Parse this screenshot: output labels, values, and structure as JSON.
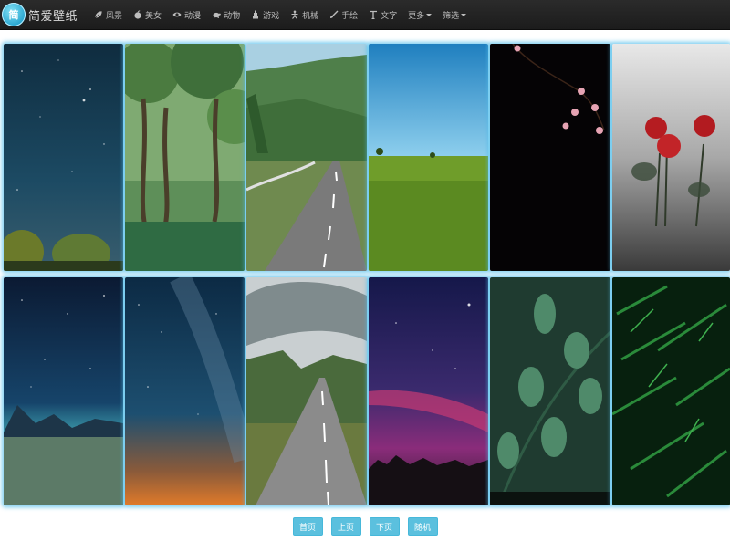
{
  "site": {
    "logo_text": "简",
    "title": "简爱壁纸"
  },
  "nav": {
    "items": [
      {
        "label": "风景",
        "icon": "leaf-icon"
      },
      {
        "label": "美女",
        "icon": "apple-icon"
      },
      {
        "label": "动漫",
        "icon": "eye-icon"
      },
      {
        "label": "动物",
        "icon": "turtle-icon"
      },
      {
        "label": "游戏",
        "icon": "tower-icon"
      },
      {
        "label": "机械",
        "icon": "robot-icon"
      },
      {
        "label": "手绘",
        "icon": "brush-icon"
      },
      {
        "label": "文字",
        "icon": "text-icon"
      }
    ],
    "more_label": "更多",
    "filter_label": "筛选"
  },
  "gallery": {
    "wallpapers": [
      {
        "subject": "starry sky with trees"
      },
      {
        "subject": "green tree-lined path"
      },
      {
        "subject": "road through green mountains"
      },
      {
        "subject": "green wheat field and blue sky"
      },
      {
        "subject": "pink blossoms on black"
      },
      {
        "subject": "red roses in fog"
      },
      {
        "subject": "night sky over grassland"
      },
      {
        "subject": "milky way"
      },
      {
        "subject": "road into misty forest"
      },
      {
        "subject": "purple night sky"
      },
      {
        "subject": "green leaves"
      },
      {
        "subject": "ferns"
      }
    ]
  },
  "pagination": {
    "first": "首页",
    "prev": "上页",
    "next": "下页",
    "random": "随机"
  },
  "colors": {
    "navbar": "#222222",
    "accent": "#5bc0de",
    "card_glow": "#50bee b"
  }
}
